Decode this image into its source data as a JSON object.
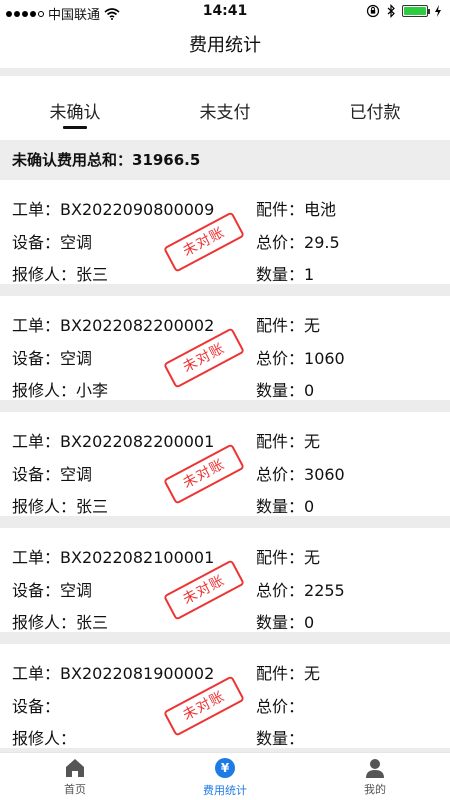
{
  "status_bar": {
    "carrier": "中国联通",
    "time": "14:41"
  },
  "header": {
    "title": "费用统计"
  },
  "tabs": [
    {
      "label": "未确认",
      "active": true
    },
    {
      "label": "未支付",
      "active": false
    },
    {
      "label": "已付款",
      "active": false
    }
  ],
  "summary": {
    "text": "未确认费用总和：31966.5"
  },
  "labels": {
    "order": "工单：",
    "device": "设备：",
    "reporter": "报修人：",
    "parts": "配件：",
    "total": "总价：",
    "qty": "数量："
  },
  "stamp_text": "未对账",
  "records": [
    {
      "order": "BX2022090800009",
      "device": "空调",
      "reporter": "张三",
      "parts": "电池",
      "total": "29.5",
      "qty": "1"
    },
    {
      "order": "BX2022082200002",
      "device": "空调",
      "reporter": "小李",
      "parts": "无",
      "total": "1060",
      "qty": "0"
    },
    {
      "order": "BX2022082200001",
      "device": "空调",
      "reporter": "张三",
      "parts": "无",
      "total": "3060",
      "qty": "0"
    },
    {
      "order": "BX2022082100001",
      "device": "空调",
      "reporter": "张三",
      "parts": "无",
      "total": "2255",
      "qty": "0"
    },
    {
      "order": "BX2022081900002",
      "device": "",
      "reporter": "",
      "parts": "无",
      "total": "",
      "qty": ""
    }
  ],
  "bottom_nav": [
    {
      "label": "首页",
      "icon": "home-icon",
      "active": false
    },
    {
      "label": "费用统计",
      "icon": "yen-icon",
      "active": true
    },
    {
      "label": "我的",
      "icon": "user-icon",
      "active": false
    }
  ],
  "colors": {
    "accent": "#1e7be6",
    "stamp": "#e33333",
    "battery": "#2ecc40"
  }
}
